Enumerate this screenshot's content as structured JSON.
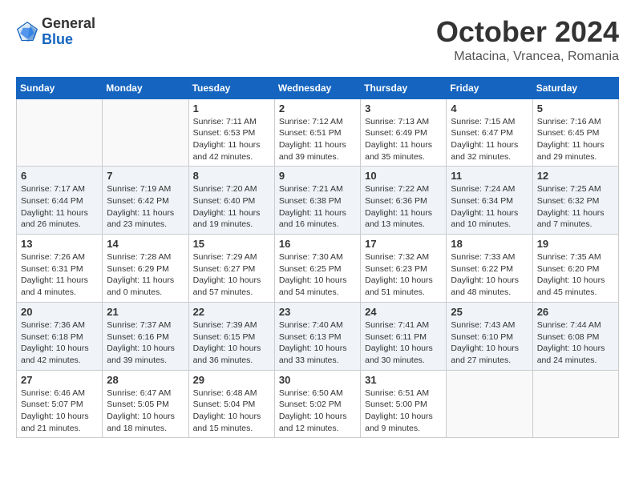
{
  "header": {
    "logo_general": "General",
    "logo_blue": "Blue",
    "month": "October 2024",
    "location": "Matacina, Vrancea, Romania"
  },
  "weekdays": [
    "Sunday",
    "Monday",
    "Tuesday",
    "Wednesday",
    "Thursday",
    "Friday",
    "Saturday"
  ],
  "weeks": [
    [
      {
        "day": "",
        "info": ""
      },
      {
        "day": "",
        "info": ""
      },
      {
        "day": "1",
        "info": "Sunrise: 7:11 AM\nSunset: 6:53 PM\nDaylight: 11 hours and 42 minutes."
      },
      {
        "day": "2",
        "info": "Sunrise: 7:12 AM\nSunset: 6:51 PM\nDaylight: 11 hours and 39 minutes."
      },
      {
        "day": "3",
        "info": "Sunrise: 7:13 AM\nSunset: 6:49 PM\nDaylight: 11 hours and 35 minutes."
      },
      {
        "day": "4",
        "info": "Sunrise: 7:15 AM\nSunset: 6:47 PM\nDaylight: 11 hours and 32 minutes."
      },
      {
        "day": "5",
        "info": "Sunrise: 7:16 AM\nSunset: 6:45 PM\nDaylight: 11 hours and 29 minutes."
      }
    ],
    [
      {
        "day": "6",
        "info": "Sunrise: 7:17 AM\nSunset: 6:44 PM\nDaylight: 11 hours and 26 minutes."
      },
      {
        "day": "7",
        "info": "Sunrise: 7:19 AM\nSunset: 6:42 PM\nDaylight: 11 hours and 23 minutes."
      },
      {
        "day": "8",
        "info": "Sunrise: 7:20 AM\nSunset: 6:40 PM\nDaylight: 11 hours and 19 minutes."
      },
      {
        "day": "9",
        "info": "Sunrise: 7:21 AM\nSunset: 6:38 PM\nDaylight: 11 hours and 16 minutes."
      },
      {
        "day": "10",
        "info": "Sunrise: 7:22 AM\nSunset: 6:36 PM\nDaylight: 11 hours and 13 minutes."
      },
      {
        "day": "11",
        "info": "Sunrise: 7:24 AM\nSunset: 6:34 PM\nDaylight: 11 hours and 10 minutes."
      },
      {
        "day": "12",
        "info": "Sunrise: 7:25 AM\nSunset: 6:32 PM\nDaylight: 11 hours and 7 minutes."
      }
    ],
    [
      {
        "day": "13",
        "info": "Sunrise: 7:26 AM\nSunset: 6:31 PM\nDaylight: 11 hours and 4 minutes."
      },
      {
        "day": "14",
        "info": "Sunrise: 7:28 AM\nSunset: 6:29 PM\nDaylight: 11 hours and 0 minutes."
      },
      {
        "day": "15",
        "info": "Sunrise: 7:29 AM\nSunset: 6:27 PM\nDaylight: 10 hours and 57 minutes."
      },
      {
        "day": "16",
        "info": "Sunrise: 7:30 AM\nSunset: 6:25 PM\nDaylight: 10 hours and 54 minutes."
      },
      {
        "day": "17",
        "info": "Sunrise: 7:32 AM\nSunset: 6:23 PM\nDaylight: 10 hours and 51 minutes."
      },
      {
        "day": "18",
        "info": "Sunrise: 7:33 AM\nSunset: 6:22 PM\nDaylight: 10 hours and 48 minutes."
      },
      {
        "day": "19",
        "info": "Sunrise: 7:35 AM\nSunset: 6:20 PM\nDaylight: 10 hours and 45 minutes."
      }
    ],
    [
      {
        "day": "20",
        "info": "Sunrise: 7:36 AM\nSunset: 6:18 PM\nDaylight: 10 hours and 42 minutes."
      },
      {
        "day": "21",
        "info": "Sunrise: 7:37 AM\nSunset: 6:16 PM\nDaylight: 10 hours and 39 minutes."
      },
      {
        "day": "22",
        "info": "Sunrise: 7:39 AM\nSunset: 6:15 PM\nDaylight: 10 hours and 36 minutes."
      },
      {
        "day": "23",
        "info": "Sunrise: 7:40 AM\nSunset: 6:13 PM\nDaylight: 10 hours and 33 minutes."
      },
      {
        "day": "24",
        "info": "Sunrise: 7:41 AM\nSunset: 6:11 PM\nDaylight: 10 hours and 30 minutes."
      },
      {
        "day": "25",
        "info": "Sunrise: 7:43 AM\nSunset: 6:10 PM\nDaylight: 10 hours and 27 minutes."
      },
      {
        "day": "26",
        "info": "Sunrise: 7:44 AM\nSunset: 6:08 PM\nDaylight: 10 hours and 24 minutes."
      }
    ],
    [
      {
        "day": "27",
        "info": "Sunrise: 6:46 AM\nSunset: 5:07 PM\nDaylight: 10 hours and 21 minutes."
      },
      {
        "day": "28",
        "info": "Sunrise: 6:47 AM\nSunset: 5:05 PM\nDaylight: 10 hours and 18 minutes."
      },
      {
        "day": "29",
        "info": "Sunrise: 6:48 AM\nSunset: 5:04 PM\nDaylight: 10 hours and 15 minutes."
      },
      {
        "day": "30",
        "info": "Sunrise: 6:50 AM\nSunset: 5:02 PM\nDaylight: 10 hours and 12 minutes."
      },
      {
        "day": "31",
        "info": "Sunrise: 6:51 AM\nSunset: 5:00 PM\nDaylight: 10 hours and 9 minutes."
      },
      {
        "day": "",
        "info": ""
      },
      {
        "day": "",
        "info": ""
      }
    ]
  ]
}
